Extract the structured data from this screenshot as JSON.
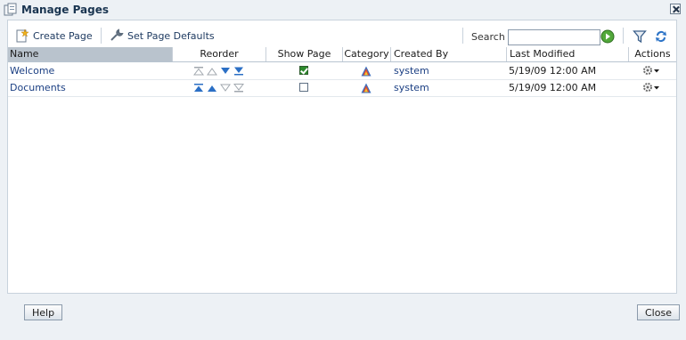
{
  "dialog": {
    "title": "Manage Pages"
  },
  "toolbar": {
    "create_label": "Create Page",
    "defaults_label": "Set Page Defaults",
    "search_label": "Search",
    "search_value": ""
  },
  "columns": [
    "Name",
    "Reorder",
    "Show Page",
    "Category",
    "Created By",
    "Last Modified",
    "Actions"
  ],
  "rows": [
    {
      "name": "Welcome",
      "show_page": true,
      "created_by": "system",
      "last_modified": "5/19/09 12:00 AM",
      "reorder": [
        "move-top",
        "move-up",
        "move-down",
        "move-bottom"
      ],
      "reorder_enabled": [
        false,
        false,
        true,
        true
      ]
    },
    {
      "name": "Documents",
      "show_page": false,
      "created_by": "system",
      "last_modified": "5/19/09 12:00 AM",
      "reorder": [
        "move-top",
        "move-up",
        "move-down",
        "move-bottom"
      ],
      "reorder_enabled": [
        true,
        true,
        false,
        false
      ]
    }
  ],
  "footer": {
    "help_label": "Help",
    "close_label": "Close"
  },
  "colors": {
    "accent": "#1b3f83",
    "header_selected": "#b9c3cd",
    "panel_bg": "#ffffff",
    "dialog_bg": "#edf1f5"
  },
  "icons": {
    "title": "manage-pages-icon",
    "create": "create-page-icon",
    "defaults": "wrench-icon",
    "go": "go-arrow-icon",
    "filter": "filter-icon",
    "refresh": "refresh-icon",
    "category": "category-triangle-icon",
    "actions": "gear-menu-icon"
  }
}
